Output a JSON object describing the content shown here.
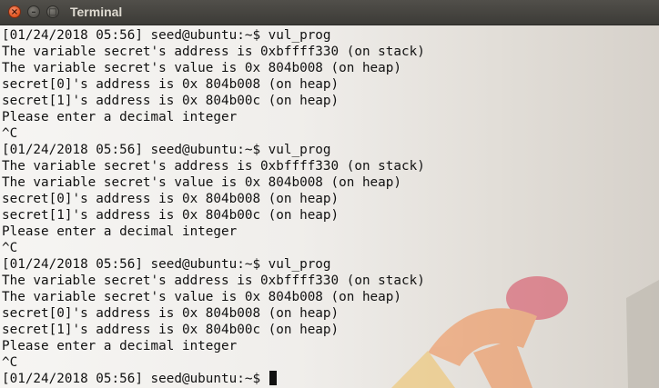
{
  "window": {
    "title": "Terminal",
    "buttons": {
      "close_glyph": "×",
      "minimize_glyph": "–",
      "maximize_glyph": "□"
    }
  },
  "terminal": {
    "lines": [
      "[01/24/2018 05:56] seed@ubuntu:~$ vul_prog",
      "The variable secret's address is 0xbffff330 (on stack)",
      "The variable secret's value is 0x 804b008 (on heap)",
      "secret[0]'s address is 0x 804b008 (on heap)",
      "secret[1]'s address is 0x 804b00c (on heap)",
      "Please enter a decimal integer",
      "^C",
      "[01/24/2018 05:56] seed@ubuntu:~$ vul_prog",
      "The variable secret's address is 0xbffff330 (on stack)",
      "The variable secret's value is 0x 804b008 (on heap)",
      "secret[0]'s address is 0x 804b008 (on heap)",
      "secret[1]'s address is 0x 804b00c (on heap)",
      "Please enter a decimal integer",
      "^C",
      "[01/24/2018 05:56] seed@ubuntu:~$ vul_prog",
      "The variable secret's address is 0xbffff330 (on stack)",
      "The variable secret's value is 0x 804b008 (on heap)",
      "secret[0]'s address is 0x 804b008 (on heap)",
      "secret[1]'s address is 0x 804b00c (on heap)",
      "Please enter a decimal integer",
      "^C",
      "[01/24/2018 05:56] seed@ubuntu:~$ "
    ]
  },
  "colors": {
    "titlebar": "#3c3b37",
    "close_button": "#e0541e",
    "terminal_text": "#111111"
  }
}
